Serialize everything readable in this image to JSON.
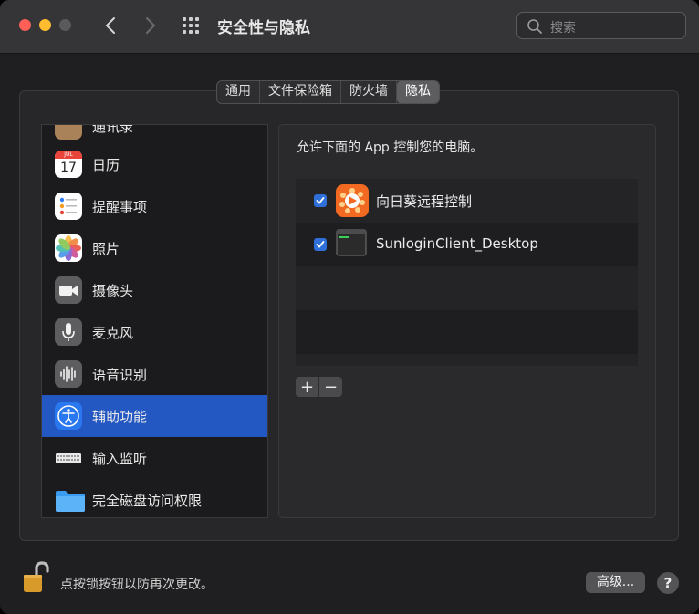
{
  "window": {
    "title": "安全性与隐私"
  },
  "search": {
    "placeholder": "搜索"
  },
  "tabs": [
    {
      "label": "通用",
      "active": false
    },
    {
      "label": "文件保险箱",
      "active": false
    },
    {
      "label": "防火墙",
      "active": false
    },
    {
      "label": "隐私",
      "active": true
    }
  ],
  "sidebar": {
    "items": [
      {
        "label": "通讯录",
        "icon": "contacts-icon"
      },
      {
        "label": "日历",
        "icon": "calendar-icon",
        "icon_text": {
          "month": "JUL",
          "day": "17"
        }
      },
      {
        "label": "提醒事项",
        "icon": "reminders-icon"
      },
      {
        "label": "照片",
        "icon": "photos-icon"
      },
      {
        "label": "摄像头",
        "icon": "camera-icon"
      },
      {
        "label": "麦克风",
        "icon": "microphone-icon"
      },
      {
        "label": "语音识别",
        "icon": "speech-recognition-icon"
      },
      {
        "label": "辅助功能",
        "icon": "accessibility-icon",
        "selected": true
      },
      {
        "label": "输入监听",
        "icon": "keyboard-icon"
      },
      {
        "label": "完全磁盘访问权限",
        "icon": "folder-icon"
      }
    ]
  },
  "main": {
    "description": "允许下面的 App 控制您的电脑。",
    "apps": [
      {
        "name": "向日葵远程控制",
        "checked": true,
        "icon": "sunflower-icon"
      },
      {
        "name": "SunloginClient_Desktop",
        "checked": true,
        "icon": "terminal-icon"
      }
    ],
    "add_label": "+",
    "remove_label": "−"
  },
  "footer": {
    "lock_message": "点按锁按钮以防再次更改。",
    "advanced_label": "高级...",
    "help_label": "?"
  },
  "colors": {
    "selection": "#2357c2",
    "checkbox": "#2f6fd9"
  }
}
